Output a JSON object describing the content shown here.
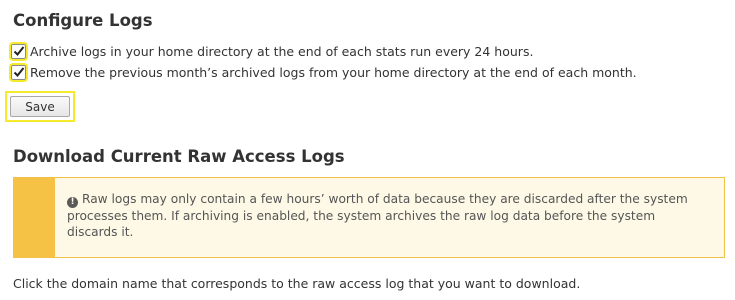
{
  "configure": {
    "title": "Configure Logs",
    "options": [
      {
        "checked": true,
        "label": "Archive logs in your home directory at the end of each stats run every 24 hours."
      },
      {
        "checked": true,
        "label": "Remove the previous month’s archived logs from your home directory at the end of each month."
      }
    ],
    "save_label": "Save"
  },
  "download": {
    "title": "Download Current Raw Access Logs",
    "alert_text": "Raw logs may only contain a few hours’ worth of data because they are discarded after the system processes them. If archiving is enabled, the system archives the raw log data before the system discards it.",
    "instruction": "Click the domain name that corresponds to the raw access log that you want to download."
  },
  "colors": {
    "highlight": "#f5ea2b",
    "alert_strip": "#f6c246",
    "alert_bg": "#fdf9e6"
  },
  "icons": {
    "alert": "exclamation-circle-icon",
    "checkbox": "checkmark-icon"
  }
}
